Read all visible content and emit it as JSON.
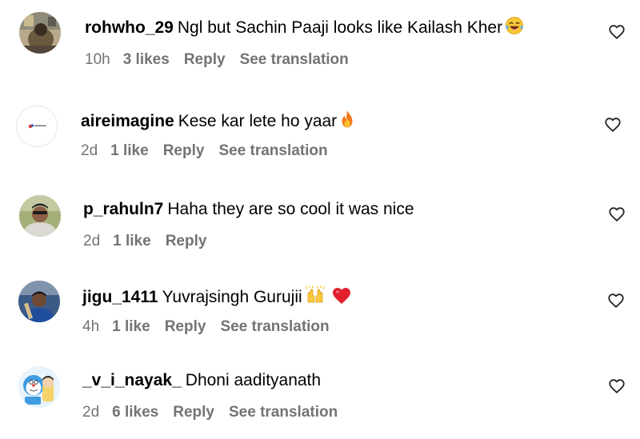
{
  "comments": [
    {
      "username": "rohwho_29",
      "text": "Ngl but Sachin Paaji looks like Kailash Kher",
      "emoji": [
        "laughing-tears-emoji"
      ],
      "time": "10h",
      "likes": "3 likes",
      "reply": "Reply",
      "translation": "See translation",
      "avatar_icon": "user-avatar-photo"
    },
    {
      "username": "aireimagine",
      "text": "Kese kar lete ho yaar",
      "emoji": [
        "fire-emoji"
      ],
      "time": "2d",
      "likes": "1 like",
      "reply": "Reply",
      "translation": "See translation",
      "avatar_icon": "brand-logo-avatar"
    },
    {
      "username": "p_rahuln7",
      "text": "Haha they are so cool it was nice",
      "emoji": [],
      "time": "2d",
      "likes": "1 like",
      "reply": "Reply",
      "translation": "",
      "avatar_icon": "user-avatar-photo"
    },
    {
      "username": "jigu_1411",
      "text": "Yuvrajsingh Gurujii",
      "emoji": [
        "raising-hands-emoji",
        "red-heart-emoji"
      ],
      "time": "4h",
      "likes": "1 like",
      "reply": "Reply",
      "translation": "See translation",
      "avatar_icon": "user-avatar-photo"
    },
    {
      "username": "_v_i_nayak_",
      "text": "Dhoni aadityanath",
      "emoji": [],
      "time": "2d",
      "likes": "6 likes",
      "reply": "Reply",
      "translation": "See translation",
      "avatar_icon": "cartoon-avatar"
    }
  ],
  "colors": {
    "primary_text": "#000000",
    "secondary_text": "#737373",
    "background": "#ffffff",
    "heart_outline": "#262626"
  },
  "icons": {
    "like": "heart-outline-icon"
  }
}
